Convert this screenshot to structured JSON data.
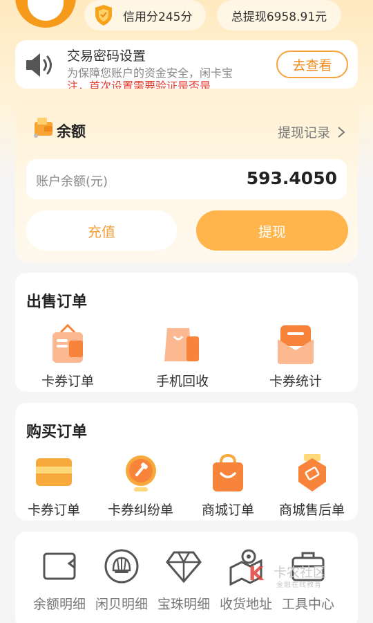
{
  "header": {
    "credit_score": "信用分245分",
    "total_withdraw": "总提现6958.91元"
  },
  "notice": {
    "title": "交易密码设置",
    "text": "为保障您账户的资金安全，闲卡宝",
    "text2": "注，首次设置需要验证是否是",
    "button": "去查看"
  },
  "balance": {
    "title": "余额",
    "record_link": "提现记录",
    "label": "账户余额(元)",
    "value": "593.4050",
    "recharge": "充值",
    "withdraw": "提现"
  },
  "sell_orders": {
    "title": "出售订单",
    "items": [
      {
        "label": "卡券订单",
        "icon": "coupon-bag-icon"
      },
      {
        "label": "手机回收",
        "icon": "shopping-bag-icon"
      },
      {
        "label": "卡券统计",
        "icon": "envelope-icon"
      }
    ]
  },
  "buy_orders": {
    "title": "购买订单",
    "items": [
      {
        "label": "卡券订单",
        "icon": "card-icon"
      },
      {
        "label": "卡券纠纷单",
        "icon": "gavel-icon"
      },
      {
        "label": "商城订单",
        "icon": "mall-bag-icon"
      },
      {
        "label": "商城售后单",
        "icon": "after-sale-icon"
      }
    ]
  },
  "tools": {
    "items": [
      {
        "label": "余额明细",
        "icon": "wallet-icon"
      },
      {
        "label": "闲贝明细",
        "icon": "shell-icon"
      },
      {
        "label": "宝珠明细",
        "icon": "diamond-icon"
      },
      {
        "label": "收货地址",
        "icon": "location-map-icon"
      },
      {
        "label": "工具中心",
        "icon": "toolbox-icon"
      }
    ]
  },
  "watermark": {
    "text": "卡农社区",
    "sub": "金融在线教育"
  },
  "colors": {
    "accent": "#ffb54c",
    "accent_text": "#f08b1b",
    "icon_orange": "#f7843a"
  }
}
